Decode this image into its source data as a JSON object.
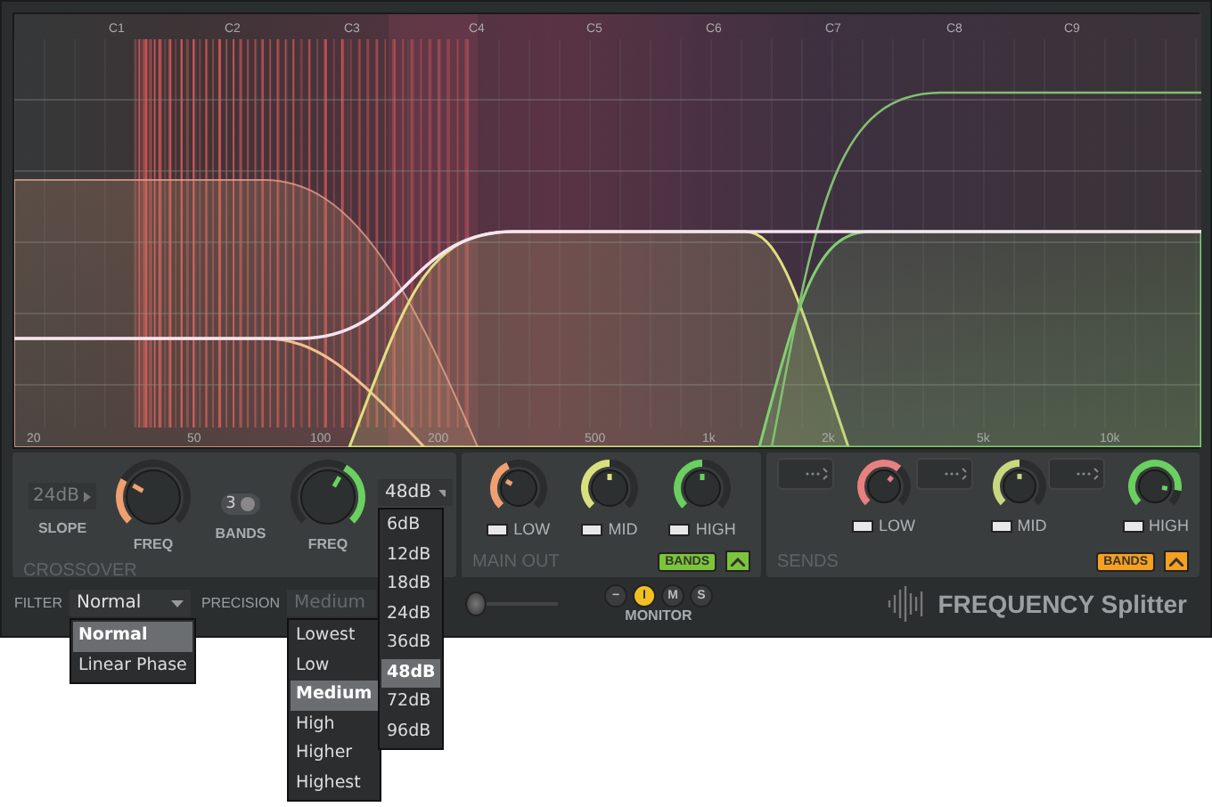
{
  "spectrum": {
    "note_labels": [
      "C1",
      "C2",
      "C3",
      "C4",
      "C5",
      "C6",
      "C7",
      "C8",
      "C9"
    ],
    "freq_labels": [
      "20",
      "50",
      "100",
      "200",
      "500",
      "1k",
      "2k",
      "5k",
      "10k"
    ]
  },
  "crossover": {
    "title": "CROSSOVER",
    "slope": {
      "label": "SLOPE",
      "value": "24dB",
      "disabled": true
    },
    "low_freq": {
      "label": "FREQ",
      "color": "#f0a070"
    },
    "bands": {
      "label": "BANDS",
      "value": "3"
    },
    "high_freq": {
      "label": "FREQ",
      "color": "#6ad060"
    },
    "slope_select": {
      "value": "48dB",
      "options": [
        {
          "label": "6dB",
          "selected": false
        },
        {
          "label": "12dB",
          "selected": false
        },
        {
          "label": "18dB",
          "selected": false
        },
        {
          "label": "24dB",
          "selected": false
        },
        {
          "label": "36dB",
          "selected": false
        },
        {
          "label": "48dB",
          "selected": true
        },
        {
          "label": "72dB",
          "selected": false
        },
        {
          "label": "96dB",
          "selected": false
        }
      ]
    }
  },
  "main_out": {
    "title": "MAIN OUT",
    "bands": [
      {
        "label": "LOW",
        "color": "#f0a070",
        "on": true
      },
      {
        "label": "MID",
        "color": "#d8e080",
        "on": true
      },
      {
        "label": "HIGH",
        "color": "#6ad060",
        "on": true
      }
    ],
    "bands_button": {
      "label": "BANDS",
      "color": "#7cc43a",
      "active": true
    }
  },
  "sends": {
    "title": "SENDS",
    "bands": [
      {
        "label": "LOW",
        "color": "#e88080",
        "on": true
      },
      {
        "label": "MID",
        "color": "#c8d880",
        "on": true
      },
      {
        "label": "HIGH",
        "color": "#6ad060",
        "on": true
      }
    ],
    "bands_button": {
      "label": "BANDS",
      "color": "#f5a020",
      "active": true
    }
  },
  "bottom": {
    "filter": {
      "label": "FILTER",
      "value": "Normal",
      "options": [
        {
          "label": "Normal",
          "selected": true
        },
        {
          "label": "Linear Phase",
          "selected": false
        }
      ]
    },
    "precision": {
      "label": "PRECISION",
      "value": "Medium",
      "disabled": true,
      "options": [
        {
          "label": "Lowest",
          "selected": false
        },
        {
          "label": "Low",
          "selected": false
        },
        {
          "label": "Medium",
          "selected": true
        },
        {
          "label": "High",
          "selected": false
        },
        {
          "label": "Higher",
          "selected": false
        },
        {
          "label": "Highest",
          "selected": false
        }
      ]
    },
    "pan_slider": {
      "level": 0.05
    },
    "monitor": {
      "label": "MONITOR",
      "buttons": [
        {
          "label": "−",
          "selected": false
        },
        {
          "label": "I",
          "selected": true
        },
        {
          "label": "M",
          "selected": false
        },
        {
          "label": "S",
          "selected": false
        }
      ]
    },
    "logo": "FREQUENCY Splitter"
  }
}
